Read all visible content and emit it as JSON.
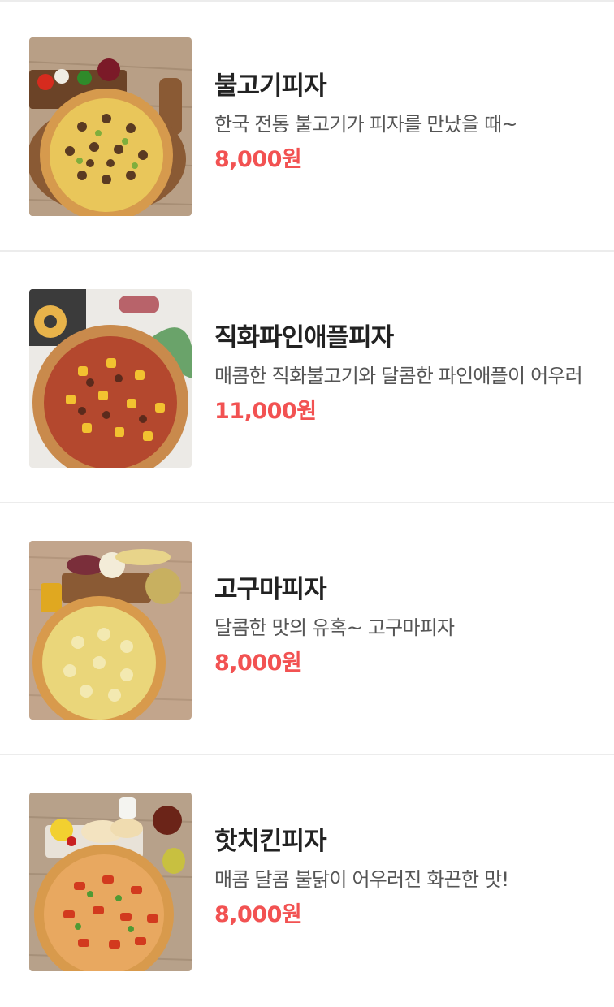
{
  "colors": {
    "price": "#f25252",
    "title": "#222222",
    "description": "#555555",
    "divider": "#ececec"
  },
  "menu_items": [
    {
      "name": "불고기피자",
      "description": "한국 전통 불고기가 피자를 만났을 때~",
      "price": "8,000원",
      "image_icon": "bulgogi-pizza-image"
    },
    {
      "name": "직화파인애플피자",
      "description": "매콤한 직화불고기와 달콤한 파인애플이 어우러",
      "price": "11,000원",
      "image_icon": "pineapple-pizza-image"
    },
    {
      "name": "고구마피자",
      "description": "달콤한 맛의 유혹~ 고구마피자",
      "price": "8,000원",
      "image_icon": "sweet-potato-pizza-image"
    },
    {
      "name": "핫치킨피자",
      "description": "매콤 달콤 불닭이 어우러진 화끈한 맛!",
      "price": "8,000원",
      "image_icon": "hot-chicken-pizza-image"
    }
  ]
}
